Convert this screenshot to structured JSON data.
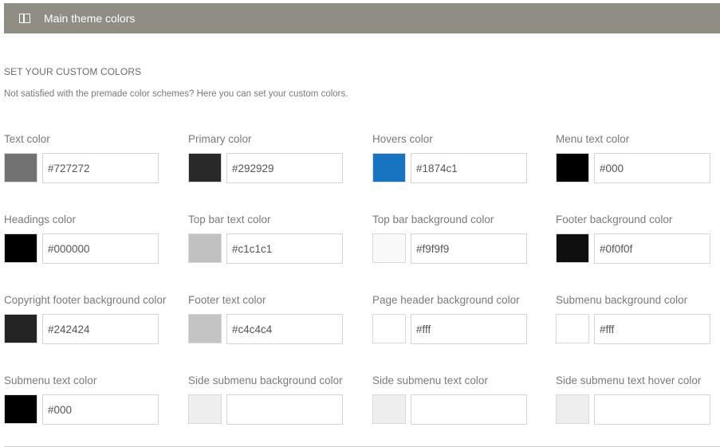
{
  "panel": {
    "title": "Main theme colors",
    "icon": "columns-icon"
  },
  "section": {
    "title": "SET YOUR CUSTOM COLORS",
    "description": "Not satisfied with the premade color schemes? Here you can set your custom colors."
  },
  "fields": [
    {
      "label": "Text color",
      "value": "#727272",
      "swatch": "#727272"
    },
    {
      "label": "Primary color",
      "value": "#292929",
      "swatch": "#292929"
    },
    {
      "label": "Hovers color",
      "value": "#1874c1",
      "swatch": "#1874c1"
    },
    {
      "label": "Menu text color",
      "value": "#000",
      "swatch": "#000000"
    },
    {
      "label": "Headings color",
      "value": "#000000",
      "swatch": "#000000"
    },
    {
      "label": "Top bar text color",
      "value": "#c1c1c1",
      "swatch": "#c1c1c1"
    },
    {
      "label": "Top bar background color",
      "value": "#f9f9f9",
      "swatch": "#f9f9f9"
    },
    {
      "label": "Footer background color",
      "value": "#0f0f0f",
      "swatch": "#0f0f0f"
    },
    {
      "label": "Copyright footer background color",
      "value": "#242424",
      "swatch": "#242424"
    },
    {
      "label": "Footer text color",
      "value": "#c4c4c4",
      "swatch": "#c4c4c4"
    },
    {
      "label": "Page header background color",
      "value": "#fff",
      "swatch": "#ffffff"
    },
    {
      "label": "Submenu background color",
      "value": "#fff",
      "swatch": "#ffffff"
    },
    {
      "label": "Submenu text color",
      "value": "#000",
      "swatch": "#000000"
    },
    {
      "label": "Side submenu background color",
      "value": "",
      "swatch": "#eeeeee"
    },
    {
      "label": "Side submenu text color",
      "value": "",
      "swatch": "#eeeeee"
    },
    {
      "label": "Side submenu text hover color",
      "value": "",
      "swatch": "#eeeeee"
    }
  ]
}
